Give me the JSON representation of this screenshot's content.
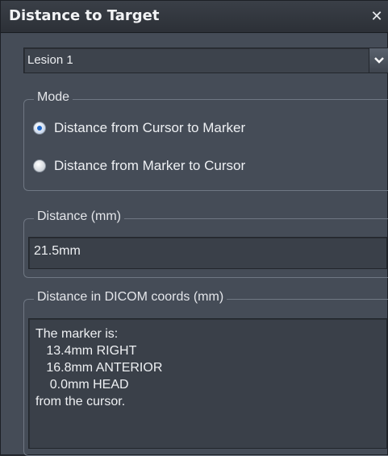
{
  "window": {
    "title": "Distance to Target"
  },
  "lesion_select": {
    "selected": "Lesion 1"
  },
  "mode": {
    "label": "Mode",
    "options": [
      {
        "label": "Distance from Cursor to Marker",
        "checked": true
      },
      {
        "label": "Distance from Marker to Cursor",
        "checked": false
      }
    ]
  },
  "distance": {
    "label": "Distance (mm)",
    "value": "21.5mm"
  },
  "dicom": {
    "label": "Distance in DICOM coords (mm)",
    "text": "The marker is:\n   13.4mm RIGHT\n   16.8mm ANTERIOR\n    0.0mm HEAD\nfrom the cursor."
  },
  "icons": {
    "close": "close-icon",
    "dropdown": "chevron-down-icon"
  }
}
